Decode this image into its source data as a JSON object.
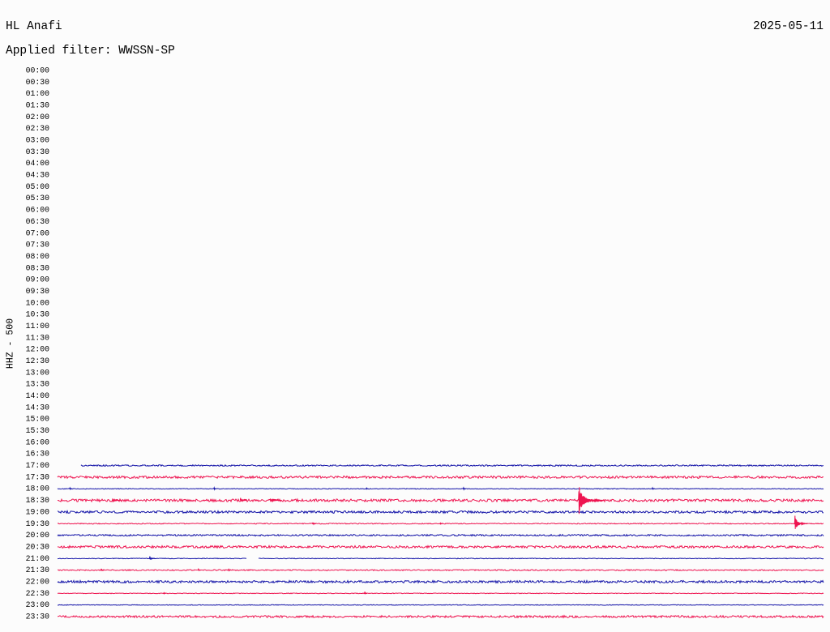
{
  "chart_data": {
    "type": "line",
    "title": "HL Anafi",
    "date": "2025-05-11",
    "subtitle": "Applied filter: WWSSN-SP",
    "ylabel": "HHZ - 500",
    "xlabel": "",
    "grid": false,
    "y_ticks": [
      "00:00",
      "00:30",
      "01:00",
      "01:30",
      "02:00",
      "02:30",
      "03:00",
      "03:30",
      "04:00",
      "04:30",
      "05:00",
      "05:30",
      "06:00",
      "06:30",
      "07:00",
      "07:30",
      "08:00",
      "08:30",
      "09:00",
      "09:30",
      "10:00",
      "10:30",
      "11:00",
      "11:30",
      "12:00",
      "12:30",
      "13:00",
      "13:30",
      "14:00",
      "14:30",
      "15:00",
      "15:30",
      "16:00",
      "16:30",
      "17:00",
      "17:30",
      "18:00",
      "18:30",
      "19:00",
      "19:30",
      "20:00",
      "20:30",
      "21:00",
      "21:30",
      "22:00",
      "22:30",
      "23:00",
      "23:30"
    ],
    "series": [
      {
        "start": "17:00",
        "color": "#1414a8",
        "data_from": "17:00:55",
        "noise": 0.06,
        "events": [],
        "gaps": []
      },
      {
        "start": "17:30",
        "color": "#ee1450",
        "noise": 0.1,
        "events": [],
        "gaps": []
      },
      {
        "start": "18:00",
        "color": "#1414a8",
        "noise": 0.03,
        "events": [
          {
            "time": "18:00:29",
            "amplitude": 0.1,
            "duration_s": 6
          },
          {
            "time": "18:06:08",
            "amplitude": 0.1,
            "duration_s": 6
          },
          {
            "time": "18:12:06",
            "amplitude": 0.08,
            "duration_s": 5
          },
          {
            "time": "18:15:54",
            "amplitude": 0.14,
            "duration_s": 6
          },
          {
            "time": "18:23:18",
            "amplitude": 0.08,
            "duration_s": 5
          }
        ],
        "gaps": []
      },
      {
        "start": "18:30",
        "color": "#ee1450",
        "noise": 0.11,
        "events": [
          {
            "time": "18:32:10",
            "amplitude": 0.16,
            "duration_s": 20
          },
          {
            "time": "18:37:10",
            "amplitude": 0.22,
            "duration_s": 15
          },
          {
            "time": "18:38:20",
            "amplitude": 0.15,
            "duration_s": 25
          },
          {
            "time": "18:50:25",
            "amplitude": 1.25,
            "duration_s": 60
          }
        ],
        "gaps": []
      },
      {
        "start": "19:00",
        "color": "#1414a8",
        "noise": 0.1,
        "events": [],
        "gaps": []
      },
      {
        "start": "19:30",
        "color": "#ee1450",
        "noise": 0.04,
        "events": [
          {
            "time": "19:40:00",
            "amplitude": 0.18,
            "duration_s": 8
          },
          {
            "time": "19:45:00",
            "amplitude": 0.08,
            "duration_s": 5
          },
          {
            "time": "19:58:53",
            "amplitude": 0.78,
            "duration_s": 30
          }
        ],
        "gaps": []
      },
      {
        "start": "20:00",
        "color": "#1414a8",
        "noise": 0.07,
        "events": [],
        "gaps": []
      },
      {
        "start": "20:30",
        "color": "#ee1450",
        "noise": 0.1,
        "events": [],
        "gaps": []
      },
      {
        "start": "21:00",
        "color": "#1414a8",
        "noise": 0.03,
        "events": [
          {
            "time": "21:03:37",
            "amplitude": 0.22,
            "duration_s": 12
          }
        ],
        "gaps": [
          [
            "21:07:24",
            "21:07:52"
          ]
        ]
      },
      {
        "start": "21:30",
        "color": "#ee1450",
        "noise": 0.05,
        "events": [
          {
            "time": "21:31:43",
            "amplitude": 0.12,
            "duration_s": 6
          },
          {
            "time": "21:35:31",
            "amplitude": 0.12,
            "duration_s": 6
          },
          {
            "time": "21:36:42",
            "amplitude": 0.1,
            "duration_s": 6
          }
        ],
        "gaps": []
      },
      {
        "start": "22:00",
        "color": "#1414a8",
        "noise": 0.1,
        "events": [],
        "gaps": []
      },
      {
        "start": "22:30",
        "color": "#ee1450",
        "noise": 0.03,
        "events": [
          {
            "time": "22:34:10",
            "amplitude": 0.08,
            "duration_s": 5
          },
          {
            "time": "22:42:02",
            "amplitude": 0.14,
            "duration_s": 6
          }
        ],
        "gaps": []
      },
      {
        "start": "23:00",
        "color": "#1414a8",
        "noise": 0.03,
        "events": [
          {
            "time": "23:32:00",
            "amplitude": 0.0,
            "duration_s": 1
          }
        ],
        "gaps": []
      },
      {
        "start": "23:30",
        "color": "#ee1450",
        "noise": 0.09,
        "events": [],
        "gaps": []
      }
    ]
  }
}
